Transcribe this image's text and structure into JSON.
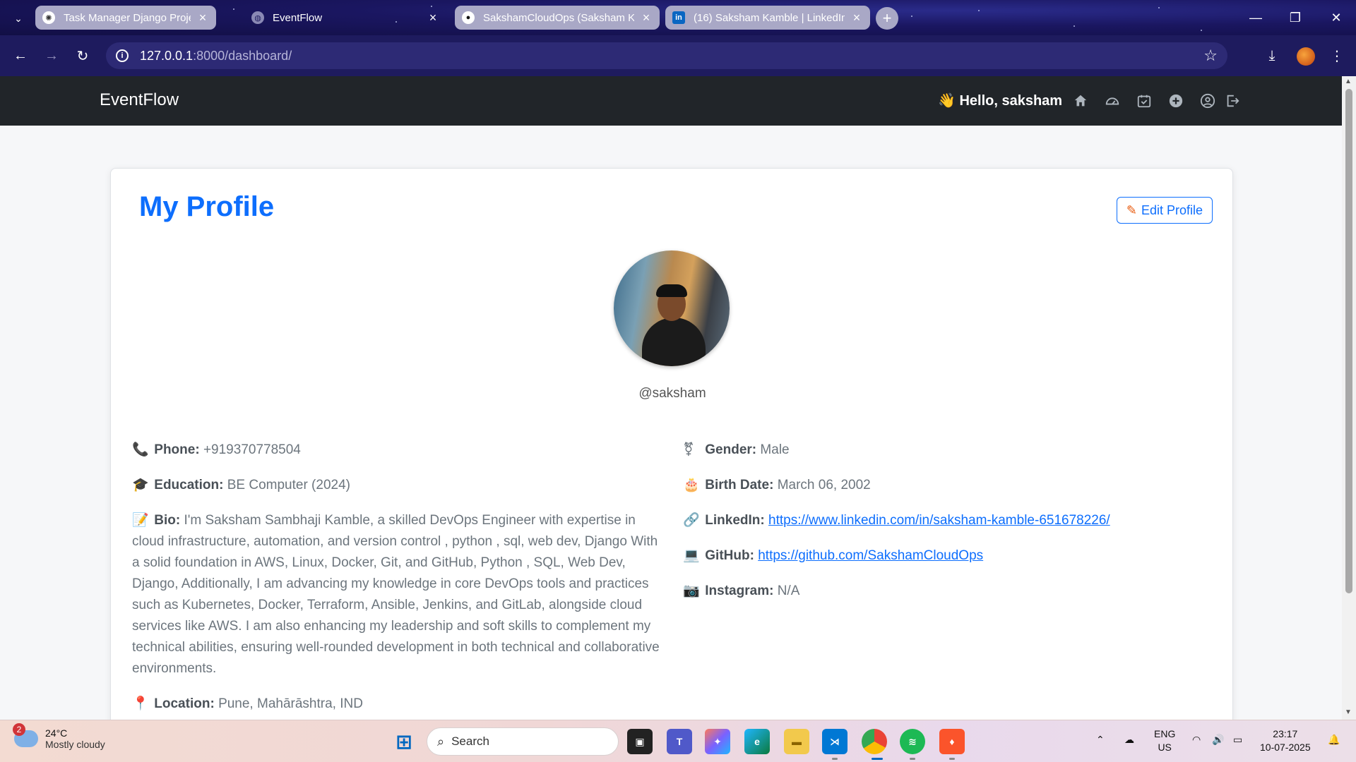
{
  "browser": {
    "tabs": [
      {
        "title": "Task Manager Django Project",
        "active": false
      },
      {
        "title": "EventFlow",
        "active": true
      },
      {
        "title": "SakshamCloudOps (Saksham K",
        "active": false
      },
      {
        "title": "(16) Saksham Kamble | LinkedIn",
        "active": false
      }
    ],
    "url_host": "127.0.0.1",
    "url_path": ":8000/dashboard/"
  },
  "navbar": {
    "brand": "EventFlow",
    "greeting": "👋 Hello, saksham"
  },
  "profile": {
    "title": "My Profile",
    "edit_label": "Edit Profile",
    "username": "@saksham",
    "left_fields": [
      {
        "emoji": "📞",
        "label": "Phone:",
        "value": "+919370778504"
      },
      {
        "emoji": "🎓",
        "label": "Education:",
        "value": "BE Computer (2024)"
      },
      {
        "emoji": "📝",
        "label": "Bio:",
        "value": "I'm Saksham Sambhaji Kamble, a skilled DevOps Engineer with expertise in cloud infrastructure, automation, and version control , python , sql, web dev, Django With a solid foundation in AWS, Linux, Docker, Git, and GitHub, Python , SQL, Web Dev, Django, Additionally, I am advancing my knowledge in core DevOps tools and practices such as Kubernetes, Docker, Terraform, Ansible, Jenkins, and GitLab, alongside cloud services like AWS. I am also enhancing my leadership and soft skills to complement my technical abilities, ensuring well-rounded development in both technical and collaborative environments."
      },
      {
        "emoji": "📍",
        "label": "Location:",
        "value": "Pune, Mahārāshtra, IND"
      }
    ],
    "right_fields": [
      {
        "emoji": "⚧",
        "label": "Gender:",
        "value": "Male"
      },
      {
        "emoji": "🎂",
        "label": "Birth Date:",
        "value": "March 06, 2002"
      },
      {
        "emoji": "🔗",
        "label": "LinkedIn:",
        "value": "https://www.linkedin.com/in/saksham-kamble-651678226/"
      },
      {
        "emoji": "💻",
        "label": "GitHub:",
        "value": "https://github.com/SakshamCloudOps"
      },
      {
        "emoji": "📷",
        "label": "Instagram:",
        "value": "N/A"
      }
    ]
  },
  "taskbar": {
    "weather_temp": "24°C",
    "weather_desc": "Mostly cloudy",
    "weather_badge": "2",
    "search_label": "Search",
    "lang_top": "ENG",
    "lang_bottom": "US",
    "time": "23:17",
    "date": "10-07-2025"
  },
  "colors": {
    "accent": "#0d6efd",
    "navbar_bg": "#212529",
    "chrome_bg": "#1e1b5e"
  }
}
